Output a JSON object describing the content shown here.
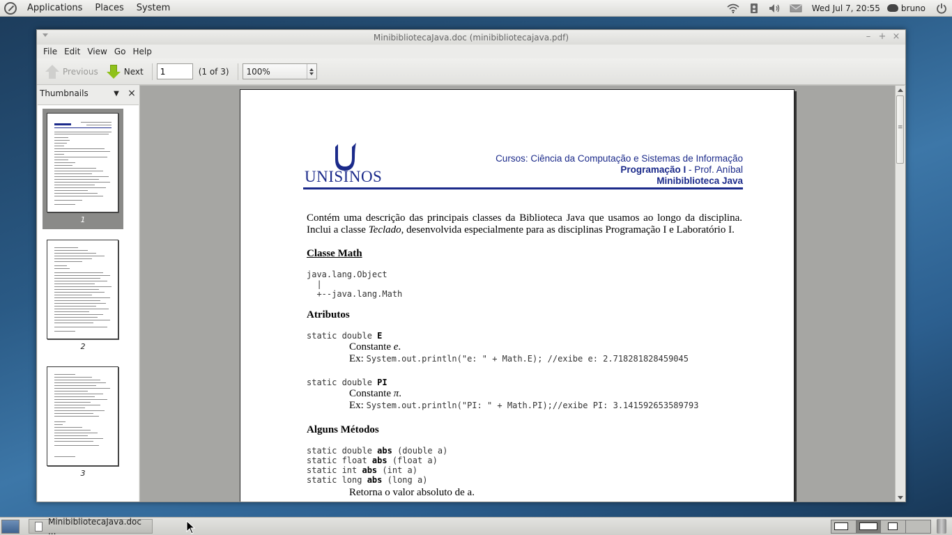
{
  "top_panel": {
    "menus": [
      "Applications",
      "Places",
      "System"
    ],
    "clock": "Wed Jul  7, 20:55",
    "user": "bruno"
  },
  "window": {
    "title": "MinibibliotecaJava.doc (minibibliotecajava.pdf)",
    "menus": [
      "File",
      "Edit",
      "View",
      "Go",
      "Help"
    ],
    "toolbar": {
      "previous_label": "Previous",
      "next_label": "Next",
      "page_value": "1",
      "page_count": "(1 of 3)",
      "zoom_value": "100%"
    },
    "sidebar": {
      "title": "Thumbnails",
      "thumbnails": [
        {
          "label": "1",
          "selected": true
        },
        {
          "label": "2",
          "selected": false
        },
        {
          "label": "3",
          "selected": false
        }
      ]
    }
  },
  "document": {
    "logo_text": "UNISINOS",
    "header_line1": "Cursos: Ciência da Computação e Sistemas de Informação",
    "header_line2_bold": "Programação I",
    "header_line2_rest": " - Prof. Aníbal",
    "header_line3": "Minibiblioteca Java",
    "intro_a": "Contém uma descrição das principais classes da Biblioteca Java que usamos ao longo da disciplina. Inclui a classe ",
    "intro_italic": "Teclado",
    "intro_b": ", desenvolvida especialmente para as disciplinas Programação I e Laboratório I.",
    "section_math": "Classe Math",
    "hierarchy_1": "java.lang.Object",
    "hierarchy_2": "  |",
    "hierarchy_3": "  +--java.lang.Math",
    "atributos": "Atributos",
    "e_decl": "static double ",
    "e_name": "E",
    "e_desc_a": "Constante ",
    "e_desc_i": "e",
    "e_desc_b": ".",
    "e_ex_label": "Ex: ",
    "e_ex_code": "System.out.println(\"e:  \" + Math.E); //exibe e: 2.718281828459045",
    "pi_decl": "static double ",
    "pi_name": "PI",
    "pi_desc_a": "Constante ",
    "pi_desc_i": "π",
    "pi_desc_b": ".",
    "pi_ex_label": "Ex: ",
    "pi_ex_code": "System.out.println(\"PI: \" + Math.PI);//exibe PI: 3.141592653589793",
    "metodos": "Alguns Métodos",
    "m1_a": "static double ",
    "m1_b": "abs",
    "m1_c": " (double a)",
    "m2_a": "static float ",
    "m2_b": "abs",
    "m2_c": " (float a)",
    "m3_a": "static int ",
    "m3_b": "abs",
    "m3_c": " (int a)",
    "m4_a": "static long ",
    "m4_b": "abs",
    "m4_c": " (long a)",
    "abs_desc": "Retorna o valor absoluto de a."
  },
  "taskbar": {
    "task_label": "MinibibliotecaJava.doc ..."
  },
  "colors": {
    "unisinos_blue": "#1b2a8a",
    "next_arrow_green": "#8fc11a"
  }
}
